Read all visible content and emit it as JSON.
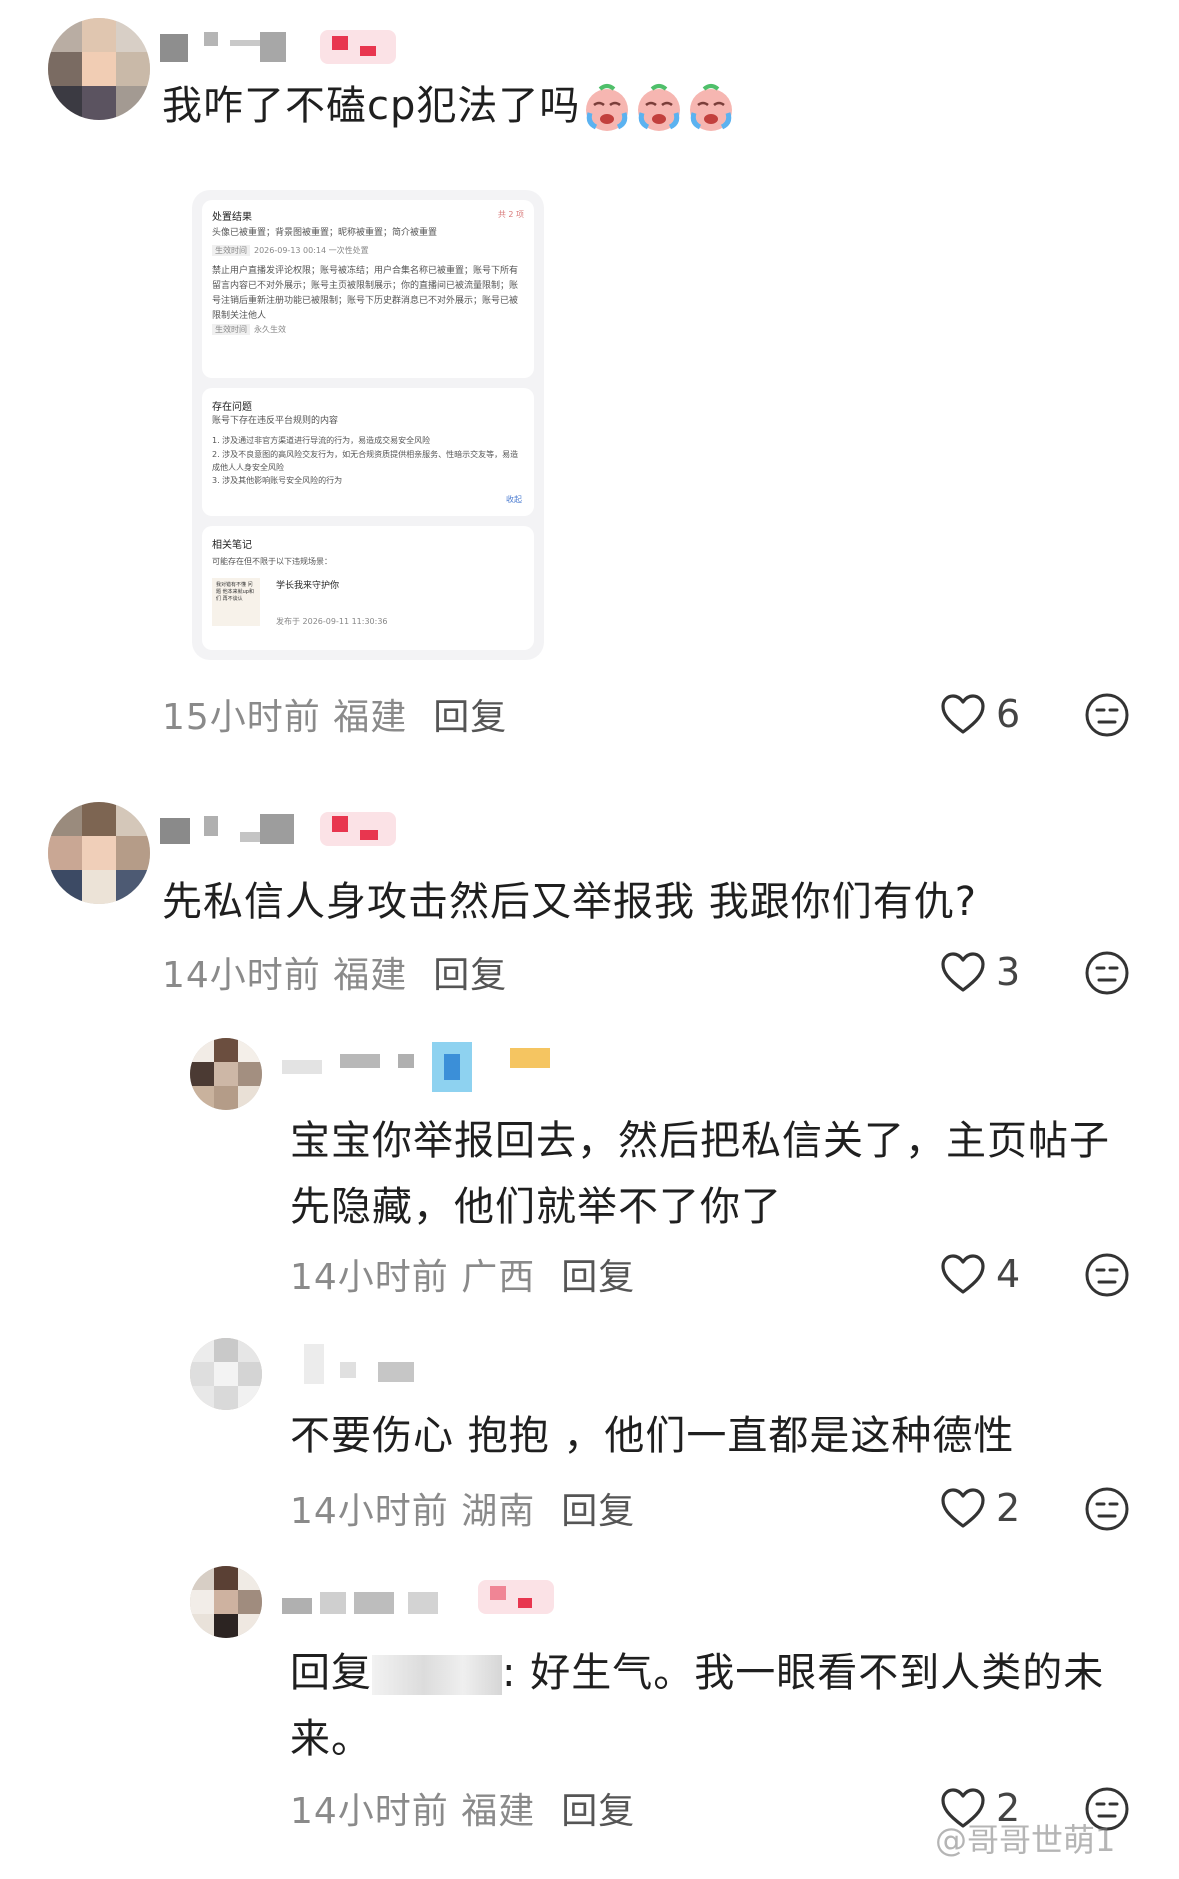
{
  "comments": [
    {
      "text": "我咋了不磕cp犯法了吗",
      "time": "15小时前",
      "location": "福建",
      "reply": "回复",
      "likes": "6"
    },
    {
      "text": "先私信人身攻击然后又举报我 我跟你们有仇?",
      "time": "14小时前",
      "location": "福建",
      "reply": "回复",
      "likes": "3"
    },
    {
      "text": "宝宝你举报回去，然后把私信关了，主页帖子先隐藏，他们就举不了你了",
      "time": "14小时前",
      "location": "广西",
      "reply": "回复",
      "likes": "4"
    },
    {
      "text": "不要伤心 抱抱 ，他们一直都是这种德性",
      "time": "14小时前",
      "location": "湖南",
      "reply": "回复",
      "likes": "2"
    },
    {
      "reply_prefix": "回复",
      "text": ": 好生气。我一眼看不到人类的未来。",
      "time": "14小时前",
      "location": "福建",
      "reply": "回复",
      "likes": "2"
    }
  ],
  "screenshot": {
    "result_title": "处置结果",
    "result_count": "共 2 项",
    "result_line1": "头像已被重置；背景图被重置；昵称被重置；简介被重置",
    "effect_label": "生效时间",
    "effect_time1": "2026-09-13 00:14 一次性处置",
    "result_line2": "禁止用户直播发评论权限；账号被冻结；用户合集名称已被重置；账号下所有留言内容已不对外展示；账号主页被限制展示；你的直播间已被流量限制；账号注销后重新注册功能已被限制；账号下历史群消息已不对外展示；账号已被限制关注他人",
    "effect_time2": "永久生效",
    "issue_title": "存在问题",
    "issue_sub": "账号下存在违反平台规则的内容",
    "issue_1": "1. 涉及通过非官方渠道进行导流的行为，易造成交易安全风险",
    "issue_2": "2. 涉及不良意图的高风险交友行为，如无合规资质提供相亲服务、性暗示交友等，易造成他人人身安全风险",
    "issue_3": "3. 涉及其他影响账号安全风险的行为",
    "collapse": "收起",
    "notes_title": "相关笔记",
    "notes_sub": "可能存在但不限于以下违规场景：",
    "note_title": "学长我来守护你",
    "note_time": "发布于 2026-09-11 11:30:36",
    "note_thumb_text": "我对错有不懂 问题 他本来就up和们 再不谈认"
  },
  "watermark": "@哥哥世萌1",
  "icons": {
    "like": "heart-outline-icon",
    "dislike": "neutral-face-icon",
    "emoji": "crying-face-emoji"
  },
  "colors": {
    "text": "#1f1f1f",
    "meta": "#8a8a8a",
    "badge": "#e8364f"
  }
}
